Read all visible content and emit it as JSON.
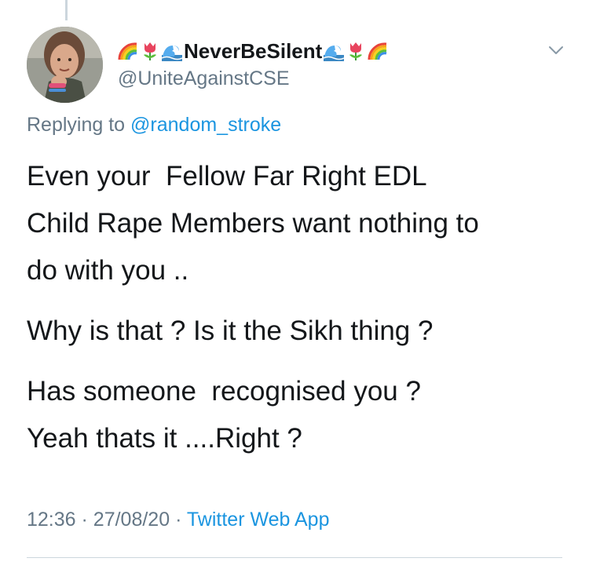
{
  "tweet": {
    "display_name": "NeverBeSilent",
    "name_emojis_left": [
      "rainbow-icon",
      "tulip-icon",
      "wave-icon"
    ],
    "name_emojis_right": [
      "wave-icon",
      "tulip-icon",
      "rainbow-icon"
    ],
    "handle": "@UniteAgainstCSE",
    "replying_prefix": "Replying to",
    "replying_to": "@random_stroke",
    "body_lines": [
      "Even your  Fellow Far Right EDL",
      "Child Rape Members want nothing to",
      "do with you ..",
      "Why is that ? Is it the Sikh thing ?",
      "Has someone  recognised you ?",
      "Yeah thats it ....Right ?"
    ],
    "time": "12:36",
    "separator": "·",
    "date": "27/08/20",
    "source": "Twitter Web App"
  },
  "colors": {
    "text": "#14171a",
    "secondary": "#657786",
    "link": "#1b95e0",
    "divider": "#ccd6dd"
  },
  "icons": {
    "more_menu": "chevron-down-icon"
  }
}
